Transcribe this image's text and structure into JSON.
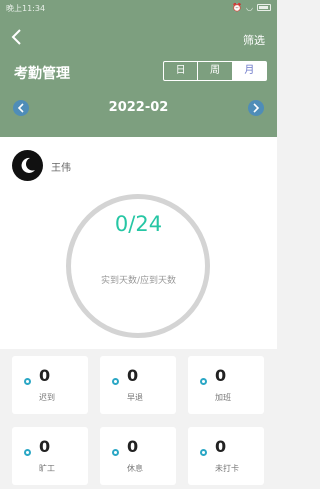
{
  "status_bar": {
    "time": "晚上11:34"
  },
  "header": {
    "filter_label": "筛选",
    "title": "考勤管理",
    "segments": [
      "日",
      "周",
      "月"
    ],
    "selected_segment": "月",
    "month": "2022-02"
  },
  "user": {
    "name": "王伟"
  },
  "summary": {
    "ratio": "0/24",
    "ratio_label": "实到天数/应到天数"
  },
  "stats": [
    {
      "value": "0",
      "label": "迟到"
    },
    {
      "value": "0",
      "label": "早退"
    },
    {
      "value": "0",
      "label": "加班"
    },
    {
      "value": "0",
      "label": "旷工"
    },
    {
      "value": "0",
      "label": "休息"
    },
    {
      "value": "0",
      "label": "未打卡"
    }
  ],
  "colors": {
    "header_bg": "#7d9f7f",
    "accent_teal": "#26c6a4",
    "dot_blue": "#2ba7c5",
    "nav_blue": "#4f8db8",
    "segment_selected_text": "#6a76c8"
  }
}
